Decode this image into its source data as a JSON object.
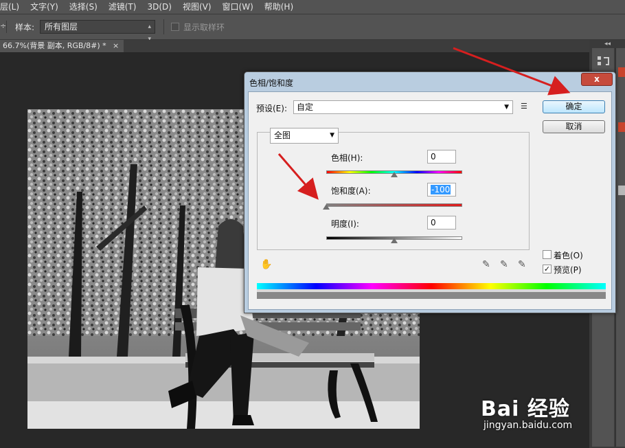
{
  "menu": [
    "层(L)",
    "文字(Y)",
    "选择(S)",
    "滤镜(T)",
    "3D(D)",
    "视图(V)",
    "窗口(W)",
    "帮助(H)"
  ],
  "options": {
    "sample_label": "样本:",
    "sample_value": "所有图层",
    "show_ring_label": "显示取样环"
  },
  "document": {
    "tab_title": "66.7%(背景 副本, RGB/8#) *",
    "tab_close": "×"
  },
  "dialog": {
    "title": "色相/饱和度",
    "close": "x",
    "preset_label": "预设(E):",
    "preset_value": "自定",
    "ok_label": "确定",
    "cancel_label": "取消",
    "channel_value": "全图",
    "hue_label": "色相(H):",
    "hue_value": "0",
    "hue_fraction": 0.5,
    "saturation_label": "饱和度(A):",
    "saturation_value": "-100",
    "saturation_fraction": 0.0,
    "lightness_label": "明度(I):",
    "lightness_value": "0",
    "lightness_fraction": 0.5,
    "colorize_label": "着色(O)",
    "colorize_checked": false,
    "preview_label": "预览(P)",
    "preview_checked": true
  },
  "watermark": {
    "logo": "Bai 经验",
    "url": "jingyan.baidu.com"
  },
  "colors": {
    "accent_arrow": "#d61f1f",
    "close_button": "#c64b3c"
  }
}
